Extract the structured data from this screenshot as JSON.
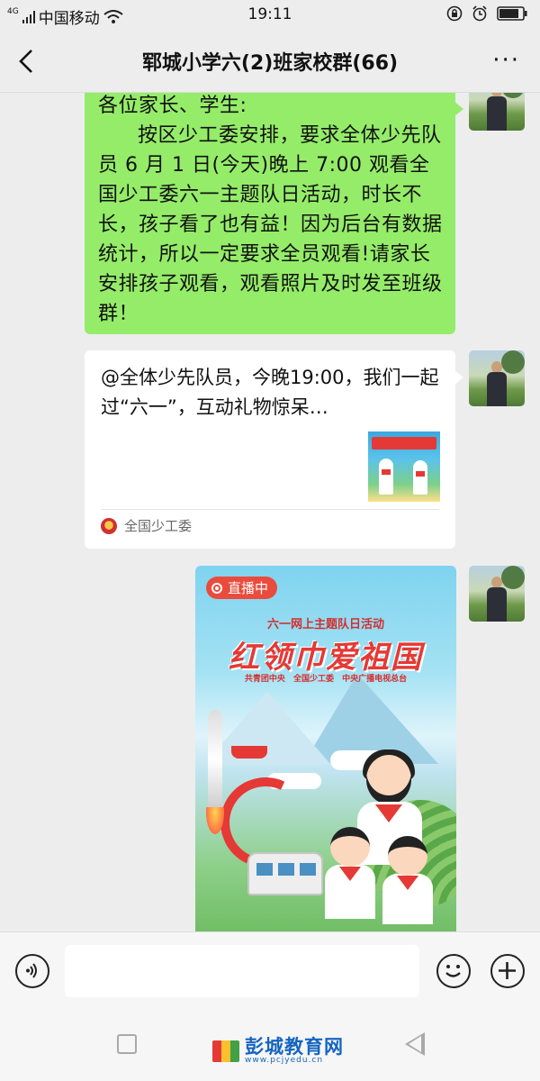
{
  "status_bar": {
    "signal_label": "4G",
    "carrier": "中国移动",
    "time": "19:11"
  },
  "nav": {
    "title": "郓城小学六(2)班家校群(66)",
    "more": "···"
  },
  "messages": {
    "text": {
      "line1": "各位家长、学生:",
      "body": "按区少工委安排，要求全体少先队员 6 月 1 日(今天)晚上 7:00 观看全国少工委六一主题队日活动，时长不长，孩子看了也有益！因为后台有数据统计，所以一定要求全员观看!请家长安排孩子观看，观看照片及时发至班级群！"
    },
    "card": {
      "title": "@全体少先队员，今晚19:00，我们一起过“六一”，互动礼物惊呆…",
      "source": "全国少工委"
    },
    "poster": {
      "live_badge": "直播中",
      "subtitle": "六一网上主题队日活动",
      "headline": "红领巾爱祖国",
      "orgs": "共青团中央 全国少工委 中央广播电视总台"
    }
  },
  "input": {
    "placeholder": ""
  },
  "watermark": {
    "name": "彭城教育网",
    "url": "www.pcjyedu.cn"
  },
  "colors": {
    "sent_bubble": "#95ec69",
    "background": "#ededed",
    "live_badge": "#ea4b3c"
  }
}
